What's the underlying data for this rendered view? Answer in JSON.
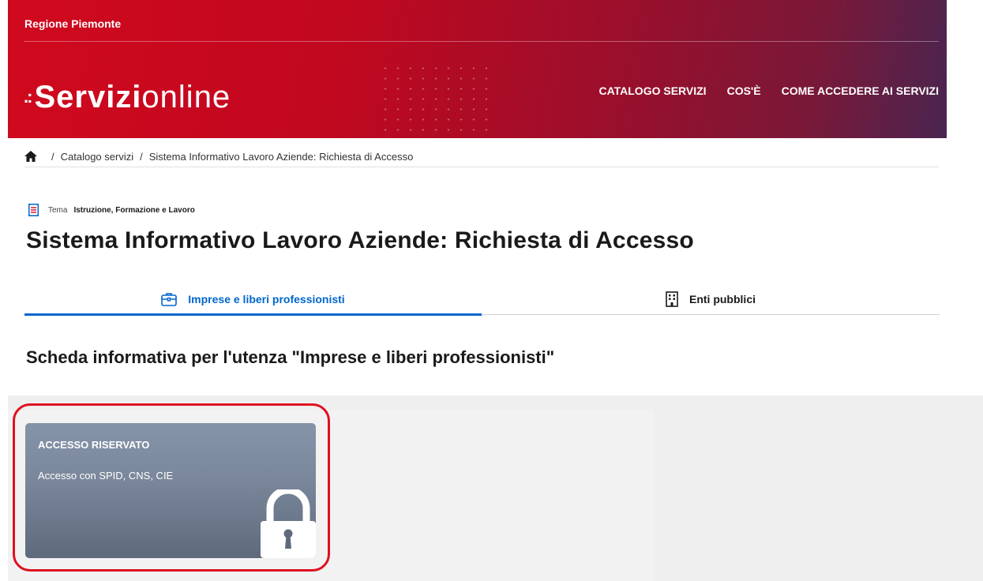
{
  "header": {
    "region": "Regione Piemonte",
    "logo_dots": ".:",
    "logo_bold": "Servizi",
    "logo_light": "online",
    "nav": [
      "CATALOGO SERVIZI",
      "COS'È",
      "COME ACCEDERE AI SERVIZI"
    ]
  },
  "breadcrumb": {
    "home_icon": "home-icon",
    "items": [
      "Catalogo servizi",
      "Sistema Informativo Lavoro Aziende: Richiesta di Accesso"
    ]
  },
  "tema": {
    "label": "Tema",
    "value": "Istruzione, Formazione e Lavoro"
  },
  "page_title": "Sistema Informativo Lavoro Aziende: Richiesta di Accesso",
  "tabs": [
    {
      "label": "Imprese e liberi professionisti",
      "icon": "briefcase-icon",
      "active": true
    },
    {
      "label": "Enti pubblici",
      "icon": "building-icon",
      "active": false
    }
  ],
  "section_title": "Scheda informativa per l'utenza \"Imprese e liberi professionisti\"",
  "card": {
    "title": "ACCESSO RISERVATO",
    "subtitle": "Accesso con SPID, CNS, CIE",
    "icon": "lock-icon"
  },
  "colors": {
    "brand_red": "#d0091e",
    "accent_blue": "#0066cc",
    "card_gray": "#7b889c",
    "highlight_red": "#e01020"
  }
}
